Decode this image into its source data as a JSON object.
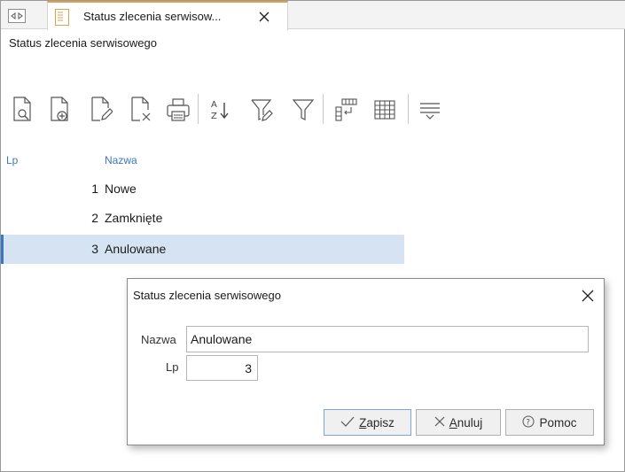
{
  "tab": {
    "label": "Status zlecenia serwisow...",
    "icon": "form-icon",
    "accent_color": "#e0a050"
  },
  "window": {
    "title": "Status zlecenia serwisowego"
  },
  "toolbar": {
    "buttons": [
      {
        "name": "preview-record",
        "icon": "document-search-icon"
      },
      {
        "name": "add-record",
        "icon": "document-add-icon"
      },
      {
        "name": "edit-record",
        "icon": "document-edit-icon"
      },
      {
        "name": "delete-record",
        "icon": "document-delete-icon"
      },
      {
        "name": "print",
        "icon": "printer-icon"
      },
      {
        "name": "sort",
        "icon": "sort-az-icon"
      },
      {
        "name": "filter-edit",
        "icon": "filter-edit-icon"
      },
      {
        "name": "filter",
        "icon": "filter-icon"
      },
      {
        "name": "columns",
        "icon": "columns-config-icon"
      },
      {
        "name": "grid",
        "icon": "grid-icon"
      },
      {
        "name": "more",
        "icon": "menu-more-icon"
      }
    ]
  },
  "grid": {
    "columns": {
      "lp": "Lp",
      "nazwa": "Nazwa"
    },
    "rows": [
      {
        "lp": "1",
        "nazwa": "Nowe"
      },
      {
        "lp": "2",
        "nazwa": "Zamknięte"
      },
      {
        "lp": "3",
        "nazwa": "Anulowane"
      }
    ],
    "selected_index": 2,
    "header_color": "#3a78c4",
    "selection_color": "#d5e3f2"
  },
  "dialog": {
    "title": "Status zlecenia serwisowego",
    "fields": {
      "nazwa_label": "Nazwa",
      "nazwa_value": "Anulowane",
      "lp_label": "Lp",
      "lp_value": "3"
    },
    "buttons": {
      "save": {
        "label_underlined": "Z",
        "label_rest": "apisz",
        "icon": "checkmark-icon"
      },
      "cancel": {
        "label_underlined": "A",
        "label_rest": "nuluj",
        "icon": "close-icon"
      },
      "help": {
        "label": "Pomoc",
        "icon": "help-circle-icon"
      }
    }
  }
}
